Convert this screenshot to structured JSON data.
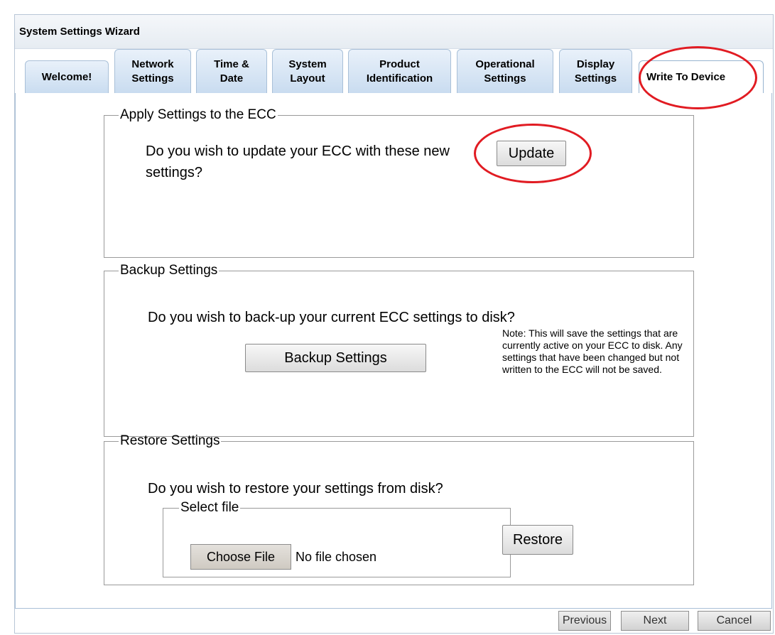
{
  "window": {
    "title": "System Settings Wizard"
  },
  "tabs": [
    {
      "label": "Welcome!"
    },
    {
      "label": "Network\nSettings"
    },
    {
      "label": "Time &\nDate"
    },
    {
      "label": "System\nLayout"
    },
    {
      "label": "Product\nIdentification"
    },
    {
      "label": "Operational\nSettings"
    },
    {
      "label": "Display\nSettings"
    },
    {
      "label": "Write To Device",
      "active": true
    }
  ],
  "apply": {
    "legend": "Apply Settings to the ECC",
    "question": "Do you wish to update your ECC with these new settings?",
    "button": "Update"
  },
  "backup": {
    "legend": "Backup Settings",
    "question": "Do you wish to back-up your current ECC settings to disk?",
    "button": "Backup Settings",
    "note": "Note: This will save the settings that are currently active on your ECC to disk. Any settings that have been changed but not written to the ECC will not be saved."
  },
  "restore": {
    "legend": "Restore Settings",
    "question": "Do you wish to restore your settings from disk?",
    "select_legend": "Select file",
    "choose_button": "Choose File",
    "file_status": "No file chosen",
    "button": "Restore"
  },
  "nav": {
    "previous": "Previous",
    "next": "Next",
    "cancel": "Cancel"
  },
  "colors": {
    "annotation": "#e11b22",
    "tab_bg": "#c9dcf0"
  }
}
